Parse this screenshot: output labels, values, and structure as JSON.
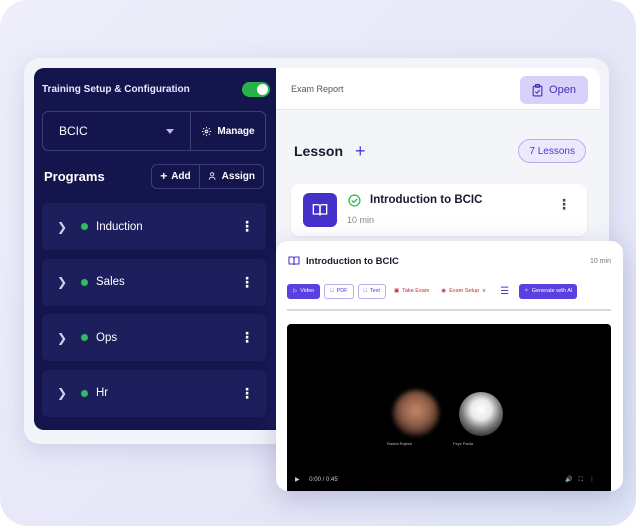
{
  "sidebar": {
    "title": "Training Setup & Configuration",
    "org_select_value": "BCIC",
    "manage_label": "Manage",
    "programs_title": "Programs",
    "add_label": "Add",
    "assign_label": "Assign",
    "programs": [
      {
        "label": "Induction"
      },
      {
        "label": "Sales"
      },
      {
        "label": "Ops"
      },
      {
        "label": "Hr"
      }
    ],
    "status_color": "#2dbd5a"
  },
  "main": {
    "exam_report_label": "Exam Report",
    "open_label": "Open",
    "lesson_title": "Lesson",
    "lessons_count_label": "7 Lessons",
    "lesson_card": {
      "title": "Introduction to BCIC",
      "duration": "10 min"
    }
  },
  "popup": {
    "title": "Introduction to BCIC",
    "duration": "10 min",
    "toolbar": {
      "video": "Video",
      "pdf": "PDF",
      "text": "Text",
      "take_exam": "Take Exam",
      "exam_setup": "Exam Setup",
      "generate_ai": "Generate with AI"
    },
    "video": {
      "participant_1": "Rasha Rajesh",
      "participant_2": "Feyz Paula",
      "time": "0:00 / 0:45"
    }
  },
  "colors": {
    "sidebar_bg": "#15154e",
    "accent": "#4b37d6",
    "toggle_on": "#28b34a"
  }
}
